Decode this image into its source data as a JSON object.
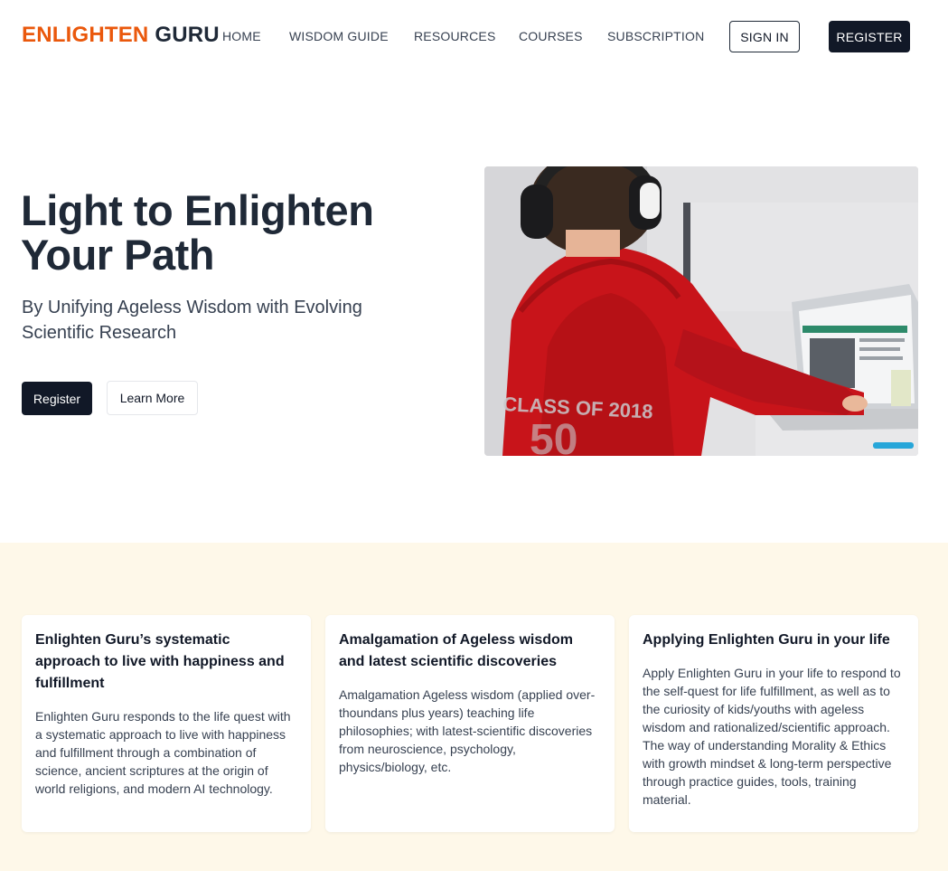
{
  "header": {
    "logo_part1": "ENLIGHTEN",
    "logo_part2": "GURU",
    "nav": [
      "HOME",
      "WISDOM GUIDE",
      "RESOURCES",
      "COURSES",
      "SUBSCRIPTION"
    ],
    "signin_label": "SIGN IN",
    "register_label": "REGISTER"
  },
  "hero": {
    "title": "Light to Enlighten Your Path",
    "subtitle": "By Unifying Ageless Wisdom with Evolving Scientific Research",
    "register_label": "Register",
    "learn_more_label": "Learn More",
    "image_overlay_text": "CLASS OF 2018"
  },
  "features": [
    {
      "title": "Enlighten Guru’s systematic approach to live with happiness and fulfillment",
      "body": "Enlighten Guru responds to the life quest with a systematic approach to live with happiness and fulfillment through a combination of science, ancient scriptures at the origin of world religions, and modern AI technology."
    },
    {
      "title": "Amalgamation of Ageless wisdom and latest scientific discoveries",
      "body": "Amalgamation Ageless wisdom (applied over-thoundans plus years) teaching life philosophies; with latest-scientific discoveries from neuroscience, psychology, physics/biology, etc."
    },
    {
      "title": "Applying Enlighten Guru in your life",
      "body": "Apply Enlighten Guru in your life to respond to the self-quest for life fulfillment, as well as to the curiosity of kids/youths with ageless wisdom and rationalized/scientific approach. The way of understanding Morality & Ethics with growth mindset & long-term perspective through practice guides, tools, training material."
    }
  ],
  "colors": {
    "brand_orange": "#ea580c",
    "dark": "#111827",
    "features_bg": "#fef8e9"
  }
}
